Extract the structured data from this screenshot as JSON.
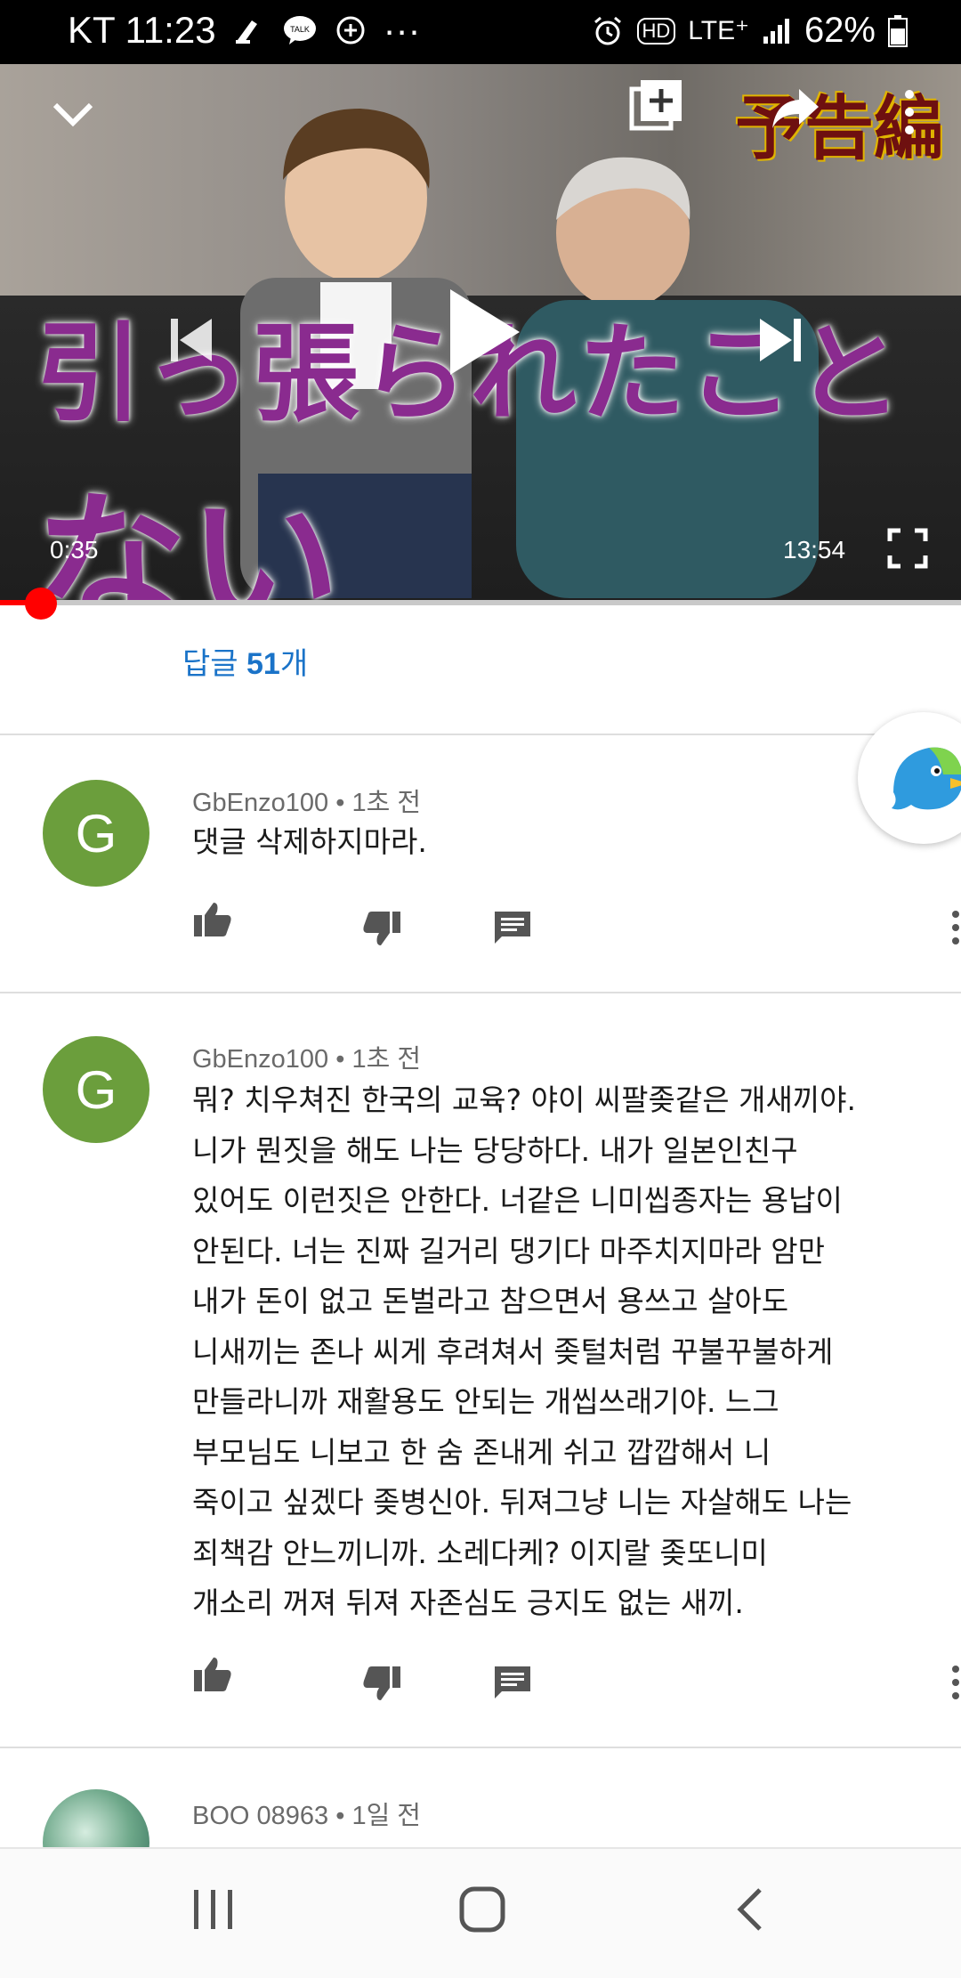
{
  "status_bar": {
    "carrier_time": "KT 11:23",
    "more": "···",
    "network": "LTE⁺",
    "hd": "HD",
    "battery": "62%"
  },
  "video": {
    "overlay_text_small": "引っ張られたこと",
    "overlay_text_big": "ない",
    "promo_label": "予告編",
    "current_time": "0:35",
    "duration": "13:54",
    "progress_fraction": 0.043
  },
  "replies": {
    "label_prefix": "답글 ",
    "count": "51",
    "label_suffix": "개"
  },
  "comments": [
    {
      "avatar_letter": "G",
      "author": "GbEnzo100",
      "time": "1초 전",
      "text": "댓글 삭제하지마라."
    },
    {
      "avatar_letter": "G",
      "author": "GbEnzo100",
      "time": "1초 전",
      "text": "뭐? 치우쳐진 한국의 교육? 야이 씨팔좆같은 개새끼야.\n니가 뭔짓을 해도 나는 당당하다. 내가 일본인친구\n있어도 이런짓은 안한다. 너같은 니미씹종자는 용납이\n안된다. 너는 진짜 길거리 댕기다 마주치지마라 암만\n내가 돈이 없고 돈벌라고 참으면서 용쓰고 살아도\n니새끼는 존나 씨게 후려쳐서 좆털처럼 꾸불꾸불하게\n만들라니까 재활용도 안되는 개씹쓰래기야. 느그\n부모님도 니보고 한 숨 존내게 쉬고 깝깝해서 니\n죽이고 싶겠다 좆병신아. 뒤져그냥 니는 자살해도 나는\n죄책감 안느끼니까. 소레다케? 이지랄 좆또니미\n개소리 꺼져 뒤져 자존심도 긍지도 없는 새끼."
    },
    {
      "author": "BOO 08963",
      "time": "1일 전"
    }
  ],
  "colors": {
    "accent_link": "#1a73c8",
    "progress": "#ff0000",
    "avatar_green": "#6b9e3c"
  },
  "icons": [
    "collapse-chevron-icon",
    "add-to-playlist-icon",
    "share-icon",
    "more-vert-icon",
    "play-icon",
    "skip-next-icon",
    "fullscreen-icon",
    "like-icon",
    "dislike-icon",
    "reply-icon",
    "papago-translate-icon",
    "recent-apps-icon",
    "home-icon",
    "back-icon"
  ]
}
